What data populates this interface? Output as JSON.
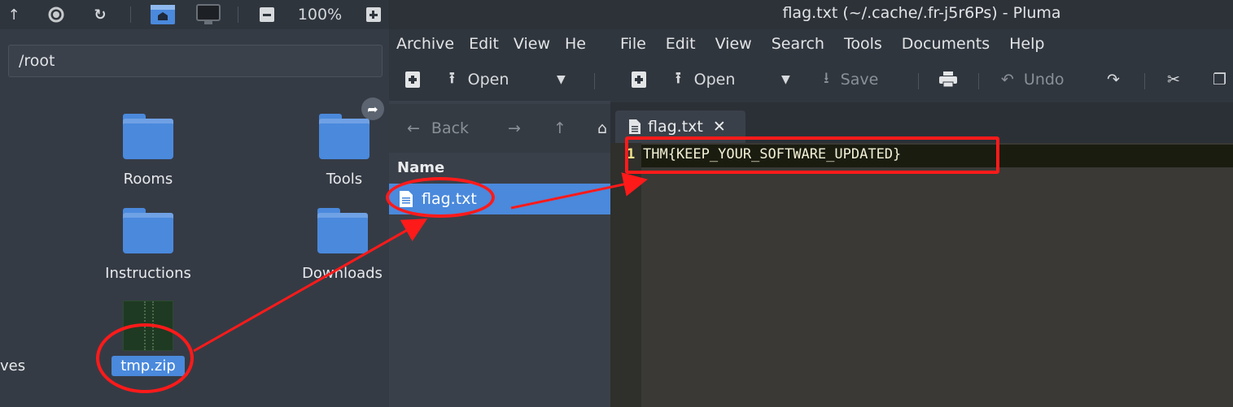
{
  "file_manager": {
    "toolbar": {
      "up_icon": "arrow-up-icon",
      "stop_icon": "stop-icon",
      "reload_icon": "reload-icon",
      "zoom_level": "100%"
    },
    "path": "/root",
    "items": [
      {
        "label": "Rooms",
        "icon": "folder-icon"
      },
      {
        "label": "Tools",
        "icon": "folder-icon"
      },
      {
        "label": "Instructions",
        "icon": "folder-icon"
      },
      {
        "label": "Downloads",
        "icon": "folder-icon"
      },
      {
        "label": "tmp.zip",
        "icon": "zip-archive-icon",
        "selected": true
      }
    ],
    "partial_label": "ves"
  },
  "archive_manager": {
    "menu": [
      "Archive",
      "Edit",
      "View",
      "He"
    ],
    "toolbar": {
      "open_label": "Open"
    },
    "nav": {
      "back_label": "Back"
    },
    "list": {
      "column_name": "Name",
      "rows": [
        {
          "name": "flag.txt",
          "selected": true
        }
      ]
    }
  },
  "pluma": {
    "window_title": "flag.txt (~/.cache/.fr-j5r6Ps) - Pluma",
    "menu": [
      "File",
      "Edit",
      "View",
      "Search",
      "Tools",
      "Documents",
      "Help"
    ],
    "toolbar": {
      "open_label": "Open",
      "save_label": "Save",
      "undo_label": "Undo"
    },
    "tab": {
      "label": "flag.txt"
    },
    "document": {
      "line_number": "1",
      "line_text": "THM{KEEP_YOUR_SOFTWARE_UPDATED}"
    }
  },
  "colors": {
    "accent": "#4a89dc",
    "annotation_red": "#ff1a1a"
  }
}
